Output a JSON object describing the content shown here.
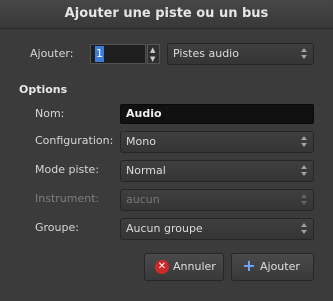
{
  "window": {
    "title": "Ajouter une piste ou un bus"
  },
  "add": {
    "label": "Ajouter:",
    "count": "1",
    "type_value": "Pistes audio"
  },
  "options": {
    "heading": "Options",
    "name_label": "Nom:",
    "name_value": "Audio",
    "config_label": "Configuration:",
    "config_value": "Mono",
    "mode_label": "Mode piste:",
    "mode_value": "Normal",
    "instrument_label": "Instrument:",
    "instrument_value": "aucun",
    "group_label": "Groupe:",
    "group_value": "Aucun groupe"
  },
  "buttons": {
    "cancel": "Annuler",
    "add": "Ajouter"
  },
  "colors": {
    "cancel_icon": "#cc2a2a",
    "add_icon": "#6fa8ff",
    "selection": "#3d7bd6"
  }
}
